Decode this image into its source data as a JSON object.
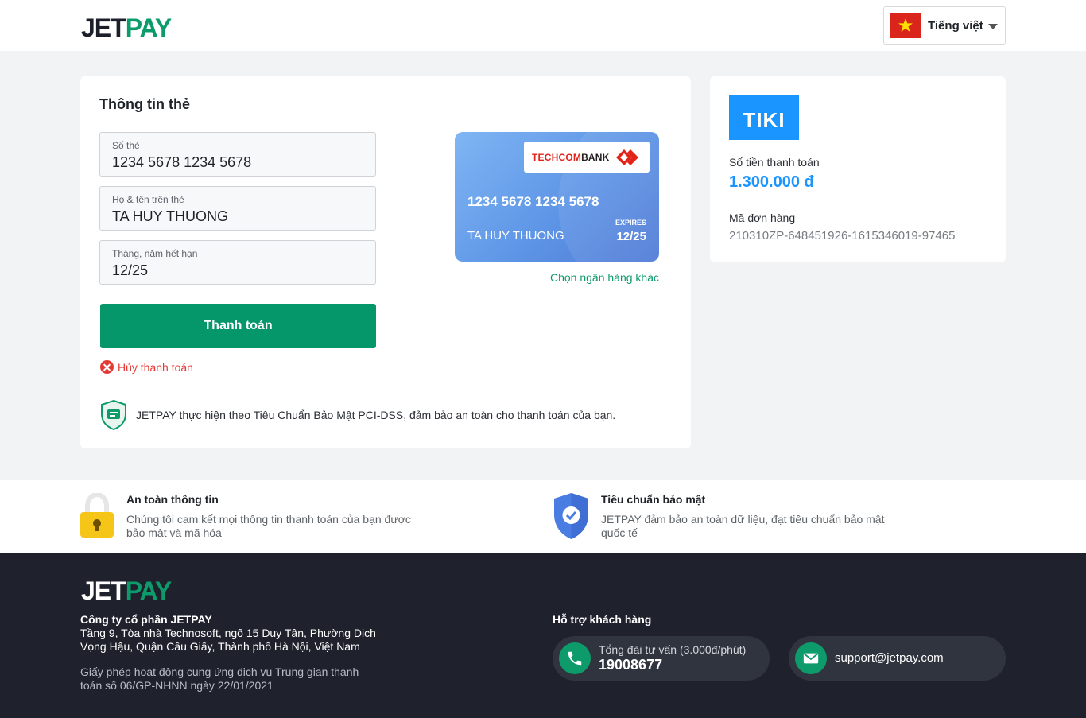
{
  "header": {
    "logo": {
      "part1": "JET",
      "part2": "PAY"
    },
    "language": {
      "label": "Tiếng việt",
      "flag": "vietnam-flag"
    }
  },
  "card_form": {
    "title": "Thông tin thẻ",
    "fields": [
      {
        "label": "Số thẻ",
        "value": "1234 5678 1234 5678"
      },
      {
        "label": "Họ & tên trên thẻ",
        "value": "TA HUY THUONG"
      },
      {
        "label": "Tháng, năm hết hạn",
        "value": "12/25"
      }
    ],
    "pay_button": "Thanh toán",
    "cancel_link": "Hủy thanh toán",
    "pci_note": "JETPAY thực hiện theo Tiêu Chuẩn Bảo Mật PCI-DSS, đảm bảo an toàn cho thanh toán của bạn."
  },
  "card_preview": {
    "bank_name_part1": "TECHCOM",
    "bank_name_part2": "BANK",
    "number": "1234 5678 1234 5678",
    "holder": "TA HUY THUONG",
    "expires_label": "EXPIRES",
    "expiry": "12/25",
    "other_bank_link": "Chọn ngân hàng khác"
  },
  "order": {
    "merchant_logo": "TIKI",
    "amount_label": "Số tiền thanh toán",
    "amount": "1.300.000 đ",
    "order_id_label": "Mã đơn hàng",
    "order_id": "210310ZP-648451926-1615346019-97465"
  },
  "features": [
    {
      "title": "An toàn thông tin",
      "desc": "Chúng tôi cam kết mọi thông tin thanh toán của bạn được bảo mật và mã hóa",
      "icon": "padlock-icon"
    },
    {
      "title": "Tiêu chuẩn bảo mật",
      "desc": "JETPAY đảm bảo an toàn dữ liệu, đạt tiêu chuẩn bảo mật quốc tế",
      "icon": "shield-check-icon"
    }
  ],
  "footer": {
    "logo": {
      "part1": "JET",
      "part2": "PAY"
    },
    "company": "Công ty cổ phần JETPAY",
    "address": "Tầng 9, Tòa nhà Technosoft, ngõ 15 Duy Tân, Phường Dịch Vọng Hậu, Quận Cầu Giấy, Thành phố Hà Nội, Việt Nam",
    "license": "Giấy phép hoạt động cung ứng dịch vụ Trung gian thanh toán số 06/GP-NHNN ngày 22/01/2021",
    "support_title": "Hỗ trợ khách hàng",
    "hotline_label": "Tổng đài tư vấn (3.000đ/phút)",
    "hotline": "19008677",
    "email": "support@jetpay.com"
  },
  "colors": {
    "brand_green": "#059669",
    "tiki_blue": "#1a94ff",
    "footer_bg": "#1f222d",
    "cancel_red": "#e53935"
  }
}
